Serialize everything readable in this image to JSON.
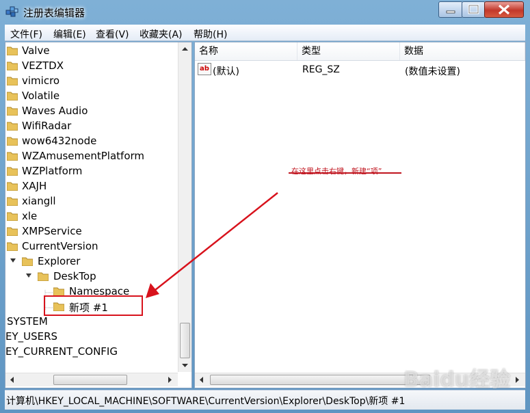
{
  "window": {
    "title": "注册表编辑器"
  },
  "menu": [
    {
      "label": "文件(F)"
    },
    {
      "label": "编辑(E)"
    },
    {
      "label": "查看(V)"
    },
    {
      "label": "收藏夹(A)"
    },
    {
      "label": "帮助(H)"
    }
  ],
  "tree": {
    "items": [
      {
        "label": "Valve"
      },
      {
        "label": "VEZTDX"
      },
      {
        "label": "vimicro"
      },
      {
        "label": "Volatile"
      },
      {
        "label": "Waves Audio"
      },
      {
        "label": "WifiRadar"
      },
      {
        "label": "wow6432node"
      },
      {
        "label": "WZAmusementPlatform"
      },
      {
        "label": "WZPlatform"
      },
      {
        "label": "XAJH"
      },
      {
        "label": "xiangll"
      },
      {
        "label": "xle"
      },
      {
        "label": "XMPService"
      },
      {
        "label": "CurrentVersion"
      },
      {
        "label": "Explorer"
      },
      {
        "label": "DeskTop"
      },
      {
        "label": "Namespace"
      },
      {
        "label": "新项 #1"
      },
      {
        "label": "SYSTEM"
      },
      {
        "label": "EY_USERS"
      },
      {
        "label": "EY_CURRENT_CONFIG"
      }
    ]
  },
  "list": {
    "columns": [
      {
        "label": "名称"
      },
      {
        "label": "类型"
      },
      {
        "label": "数据"
      }
    ],
    "rows": [
      {
        "name": "(默认)",
        "type": "REG_SZ",
        "data": "(数值未设置)",
        "icon": "ab"
      }
    ]
  },
  "annotation": {
    "text": "在这里点击右键，新建“项”"
  },
  "statusbar": {
    "path": "计算机\\HKEY_LOCAL_MACHINE\\SOFTWARE\\CurrentVersion\\Explorer\\DeskTop\\新项 #1"
  },
  "watermark": {
    "text": "Baidu经验"
  },
  "colors": {
    "annotation": "#c0141e",
    "folder": "#e8c25a",
    "titlebar": "#6fa0c8"
  }
}
